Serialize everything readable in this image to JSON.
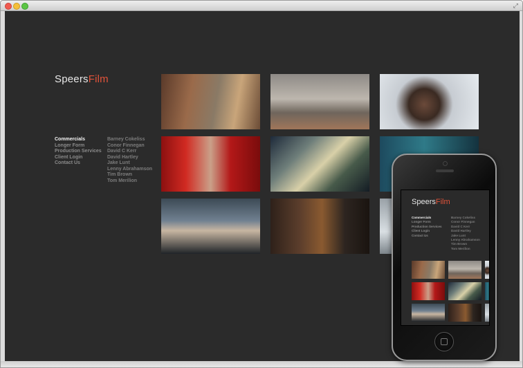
{
  "window": {
    "resize_icon": "resize-arrows-icon",
    "resize_glyph": "⤢"
  },
  "brand": {
    "name_part1": "Speers",
    "name_part2": "Film",
    "accent_color": "#e2533a"
  },
  "nav": {
    "items": [
      {
        "label": "Commercials",
        "active": true
      },
      {
        "label": "Longer Form",
        "active": false
      },
      {
        "label": "Production Services",
        "active": false
      },
      {
        "label": "Client Login",
        "active": false
      },
      {
        "label": "Contact Us",
        "active": false
      }
    ]
  },
  "directors": [
    "Barney Cokeliss",
    "Conor Finnegan",
    "David C Kerr",
    "David Hartley",
    "Jake Lunt",
    "Lenny Abrahamson",
    "Tim Brown",
    "Tom Merilion"
  ]
}
